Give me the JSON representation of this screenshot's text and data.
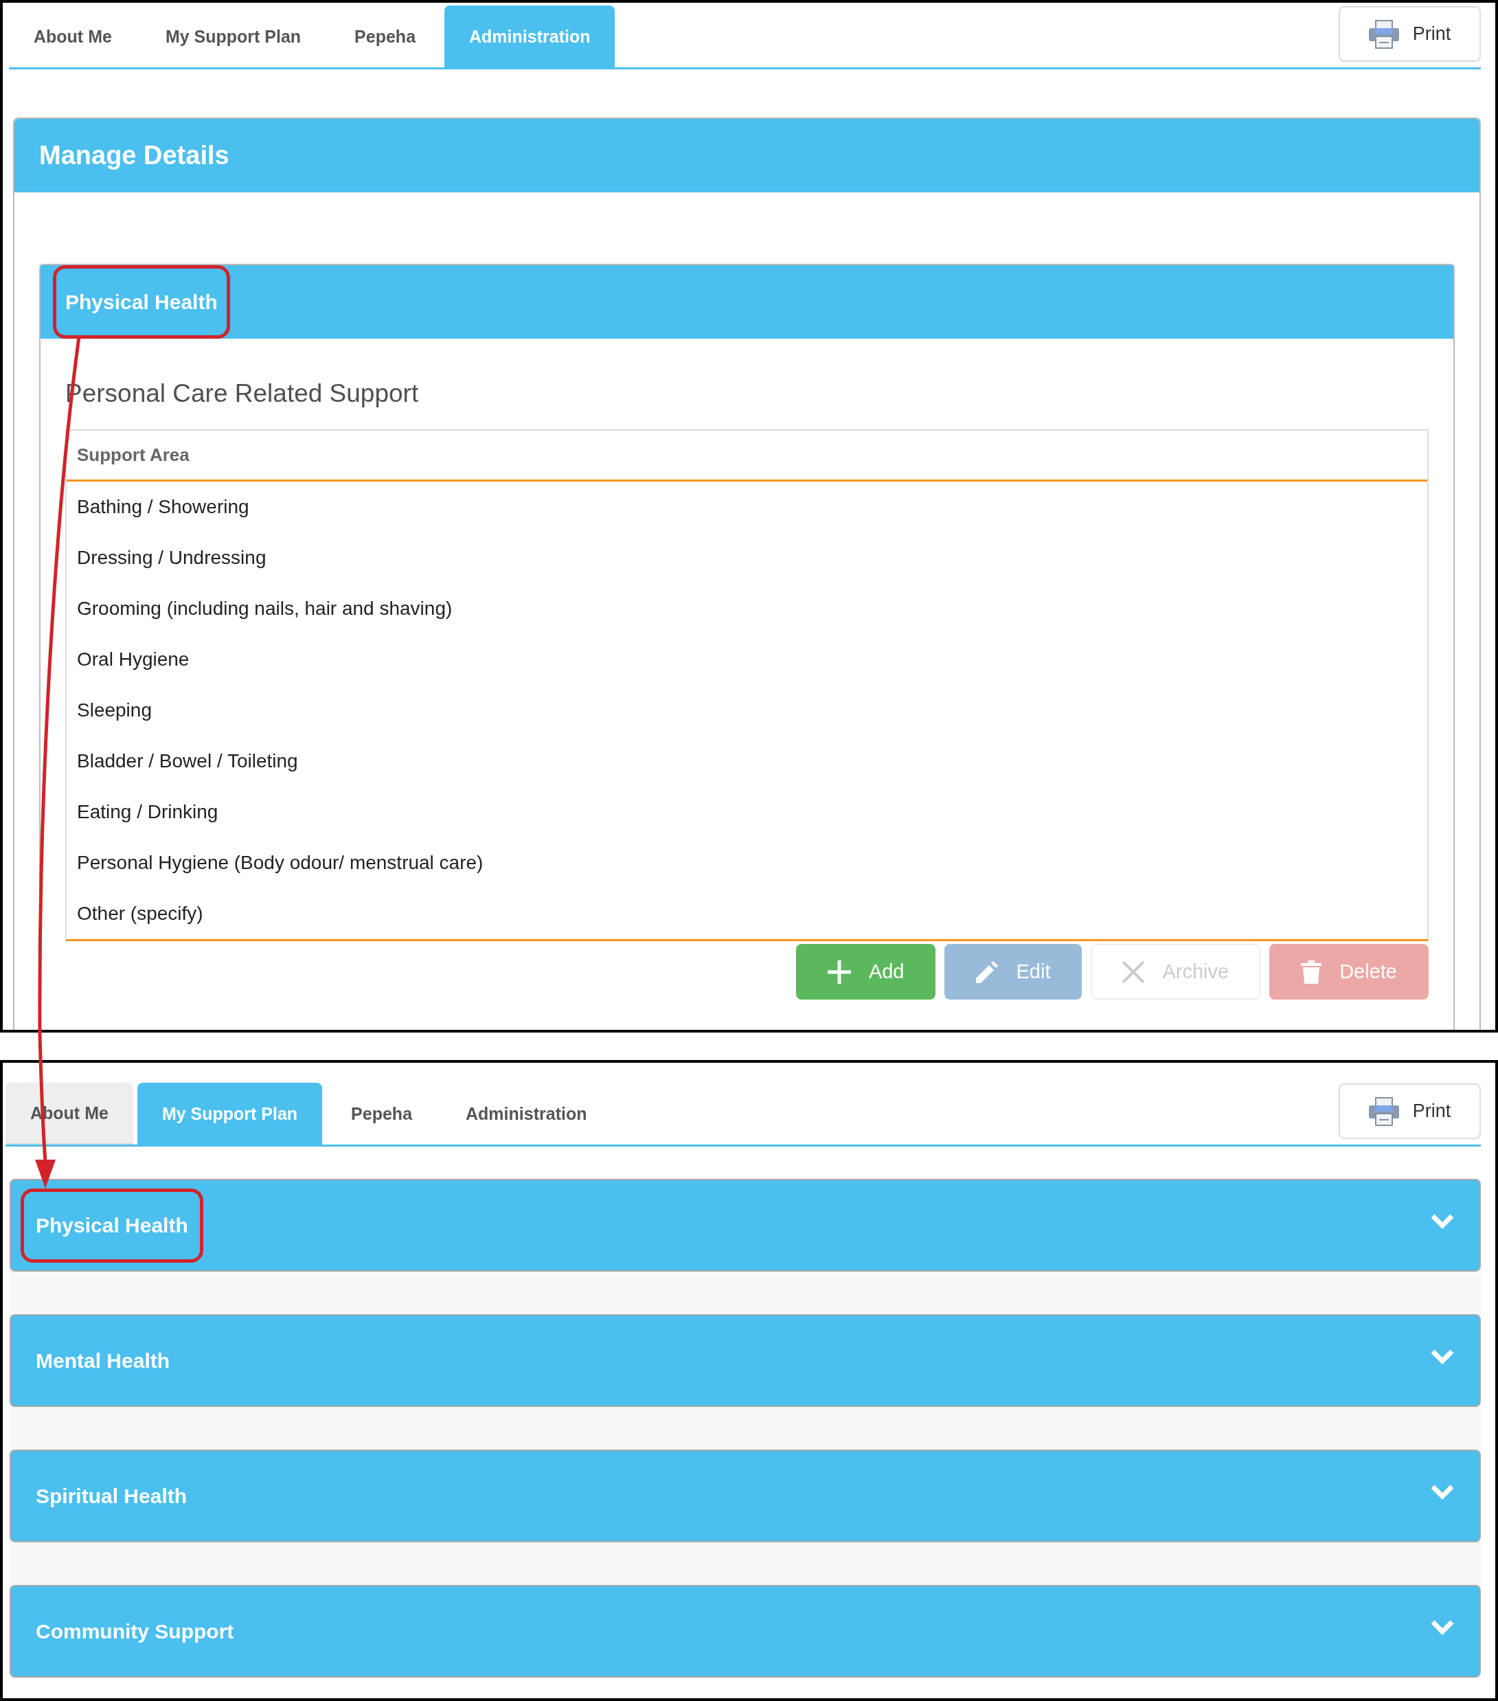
{
  "screens": [
    {
      "tabs": [
        {
          "label": "About Me",
          "selected": false
        },
        {
          "label": "My Support Plan",
          "selected": false
        },
        {
          "label": "Pepeha",
          "selected": false
        },
        {
          "label": "Administration",
          "selected": true
        }
      ],
      "print_button": "Print",
      "panel": {
        "title": "Manage Details",
        "section": {
          "title": "Physical Health",
          "highlighted": true,
          "subtitle": "Personal Care Related Support",
          "table": {
            "columns": [
              "Support Area"
            ],
            "rows": [
              [
                "Bathing / Showering"
              ],
              [
                "Dressing / Undressing"
              ],
              [
                "Grooming (including nails, hair and shaving)"
              ],
              [
                "Oral Hygiene"
              ],
              [
                "Sleeping"
              ],
              [
                "Bladder / Bowel / Toileting"
              ],
              [
                "Eating / Drinking"
              ],
              [
                "Personal Hygiene (Body odour/ menstrual care)"
              ],
              [
                "Other (specify)"
              ]
            ]
          },
          "buttons": [
            {
              "label": "Add",
              "kind": "add",
              "disabled": false
            },
            {
              "label": "Edit",
              "kind": "edit",
              "disabled": true
            },
            {
              "label": "Archive",
              "kind": "archive",
              "disabled": true
            },
            {
              "label": "Delete",
              "kind": "delete",
              "disabled": true
            }
          ]
        }
      }
    },
    {
      "tabs": [
        {
          "label": "About Me",
          "selected": false,
          "hovered": true
        },
        {
          "label": "My Support Plan",
          "selected": true,
          "hovered": false
        },
        {
          "label": "Pepeha",
          "selected": false,
          "hovered": false
        },
        {
          "label": "Administration",
          "selected": false,
          "hovered": false
        }
      ],
      "print_button": "Print",
      "accordion": [
        {
          "title": "Physical Health",
          "expanded": false,
          "highlighted": true
        },
        {
          "title": "Mental Health",
          "expanded": false,
          "highlighted": false
        },
        {
          "title": "Spiritual Health",
          "expanded": false,
          "highlighted": false
        },
        {
          "title": "Community Support",
          "expanded": false,
          "highlighted": false
        }
      ]
    }
  ],
  "annotation_arrow": true
}
